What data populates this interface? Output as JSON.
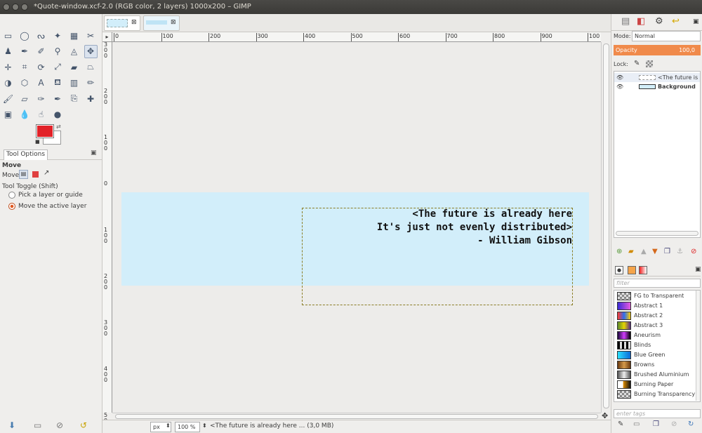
{
  "window": {
    "title": "*Quote-window.xcf-2.0 (RGB color, 2 layers) 1000x200 – GIMP"
  },
  "toolbox": {
    "tool_options_tab": "Tool Options",
    "tool_name": "Move",
    "move_label": "Move:",
    "toggle_label": "Tool Toggle  (Shift)",
    "option_pick": "Pick a layer or guide",
    "option_move": "Move the active layer"
  },
  "colors": {
    "foreground": "#e22228",
    "background": "#ffffff",
    "accent": "#f08a4b",
    "canvas_layer": "#d2eefa"
  },
  "ruler": {
    "h_ticks": [
      "0",
      "100",
      "200",
      "300",
      "400",
      "500",
      "600",
      "700",
      "800",
      "900",
      "100"
    ],
    "v_ticks": [
      "300",
      "200",
      "100",
      "0",
      "100",
      "200",
      "300",
      "400",
      "500"
    ]
  },
  "canvas": {
    "quote_lines": [
      "<The future is already here",
      "It's just not evenly distributed>",
      "- William Gibson"
    ]
  },
  "status": {
    "unit": "px",
    "zoom": "100 %",
    "message": "<The future is already here ... (3,0 MB)"
  },
  "layers_panel": {
    "mode_label": "Mode:",
    "mode_value": "Normal",
    "opacity_label": "Opacity",
    "opacity_value": "100,0",
    "lock_label": "Lock:",
    "layers": [
      {
        "name": "<The future is already here"
      },
      {
        "name": "Background"
      }
    ]
  },
  "gradients_panel": {
    "filter_placeholder": "filter",
    "tags_placeholder": "enter tags",
    "items": [
      "FG to Transparent",
      "Abstract 1",
      "Abstract 2",
      "Abstract 3",
      "Aneurism",
      "Blinds",
      "Blue Green",
      "Browns",
      "Brushed Aluminium",
      "Burning Paper",
      "Burning Transparency"
    ]
  }
}
